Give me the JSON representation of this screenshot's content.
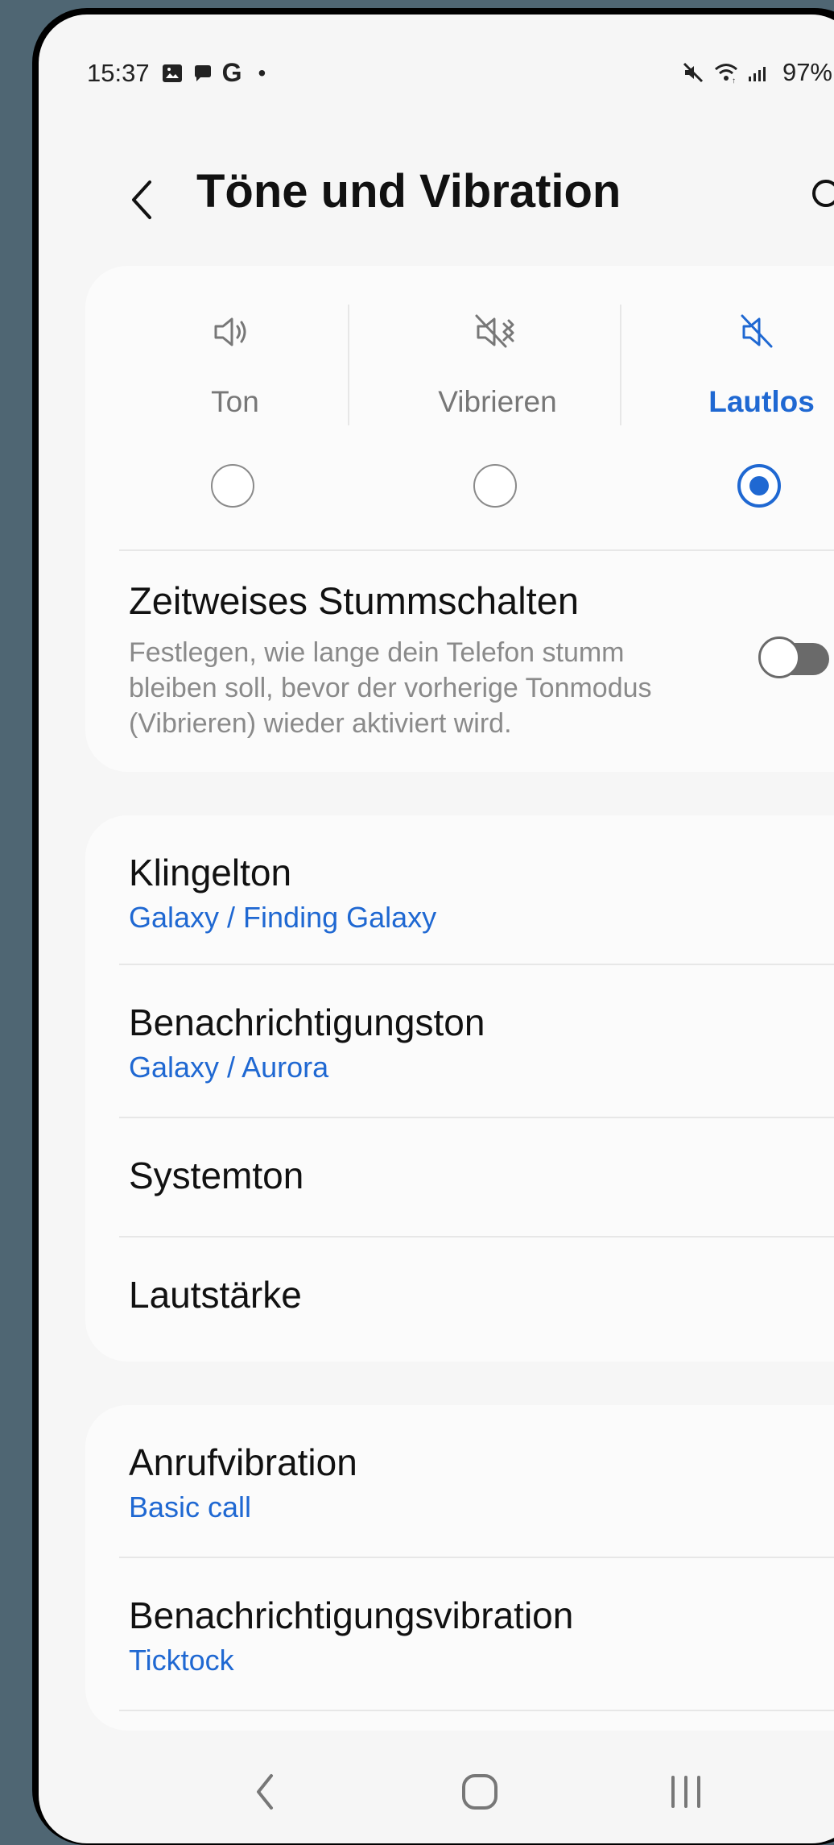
{
  "status_bar": {
    "time": "15:37",
    "left_icons": [
      "gallery-icon",
      "message-icon",
      "google-icon"
    ],
    "g_label": "G",
    "dot": "•",
    "right_icons": [
      "mute-icon",
      "wifi-icon",
      "signal-icon",
      "battery-icon"
    ],
    "battery_text": "97%"
  },
  "header": {
    "title": "Töne und Vibration"
  },
  "sound_modes": [
    {
      "label": "Ton",
      "icon": "sound-icon",
      "selected": false
    },
    {
      "label": "Vibrieren",
      "icon": "vibrate-icon",
      "selected": false
    },
    {
      "label": "Lautlos",
      "icon": "mute-icon",
      "selected": true
    }
  ],
  "temporary_mute": {
    "title": "Zeitweises Stummschalten",
    "description": "Festlegen, wie lange dein Telefon stumm bleiben soll, bevor der vorherige Tonmodus (Vibrieren) wieder aktiviert wird.",
    "enabled": false
  },
  "sound_settings": [
    {
      "title": "Klingelton",
      "subtitle": "Galaxy / Finding Galaxy"
    },
    {
      "title": "Benachrichtigungston",
      "subtitle": "Galaxy / Aurora"
    },
    {
      "title": "Systemton",
      "subtitle": ""
    },
    {
      "title": "Lautstärke",
      "subtitle": ""
    }
  ],
  "vibration_settings": [
    {
      "title": "Anrufvibration",
      "subtitle": "Basic call"
    },
    {
      "title": "Benachrichtigungsvibration",
      "subtitle": "Ticktock"
    }
  ],
  "navigation": {
    "back_icon": "back-icon",
    "home_icon": "home-icon",
    "recent_icon": "recent-apps-icon"
  },
  "colors": {
    "accent": "#1f68d2",
    "background": "#f6f6f6",
    "card": "#fbfbfb",
    "badge": "#e31b23"
  }
}
